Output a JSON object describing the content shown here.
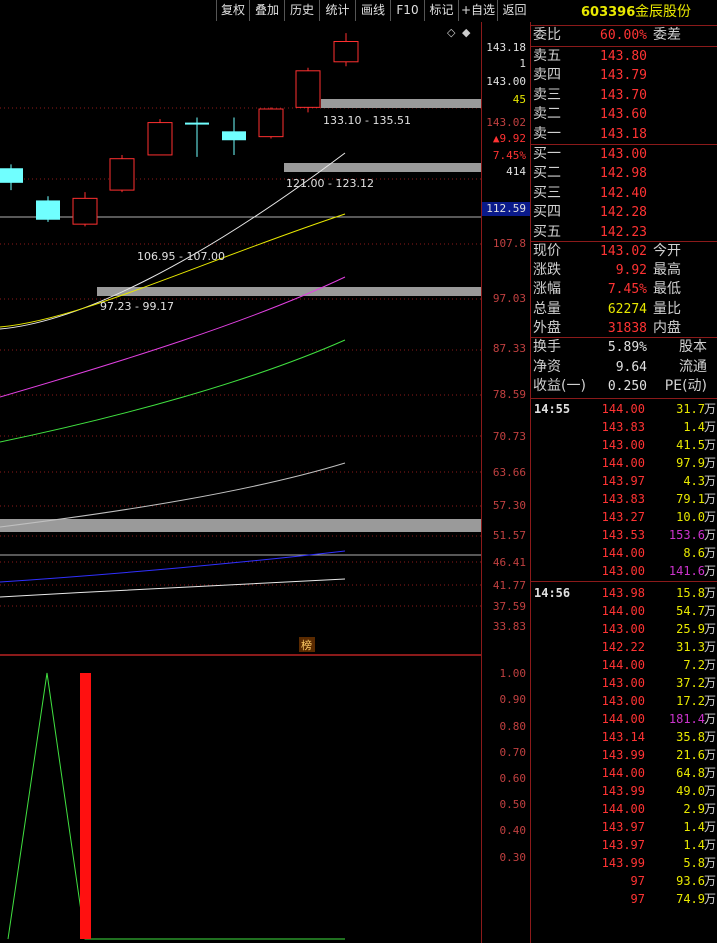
{
  "toolbar": {
    "items": [
      "复权",
      "叠加",
      "历史",
      "统计",
      "画线",
      "F10",
      "标记",
      "+自选",
      "返回"
    ]
  },
  "stock": {
    "code": "603396",
    "name": "金辰股份"
  },
  "order_ratio": {
    "label": "委比",
    "value": "60.00%",
    "label2": "委差"
  },
  "asks": [
    {
      "label": "卖五",
      "price": "143.80",
      "vol": ""
    },
    {
      "label": "卖四",
      "price": "143.79",
      "vol": ""
    },
    {
      "label": "卖三",
      "price": "143.70",
      "vol": ""
    },
    {
      "label": "卖二",
      "price": "143.60",
      "vol": ""
    },
    {
      "label": "卖一",
      "price": "143.18",
      "vol": ""
    }
  ],
  "bids": [
    {
      "label": "买一",
      "price": "143.00"
    },
    {
      "label": "买二",
      "price": "142.98"
    },
    {
      "label": "买三",
      "price": "142.40"
    },
    {
      "label": "买四",
      "price": "142.28"
    },
    {
      "label": "买五",
      "price": "142.23"
    }
  ],
  "quote": [
    {
      "l1": "现价",
      "v1": "143.02",
      "l2": "今开",
      "c": "#ff3333"
    },
    {
      "l1": "涨跌",
      "v1": "9.92",
      "l2": "最高",
      "c": "#ff3333"
    },
    {
      "l1": "涨幅",
      "v1": "7.45%",
      "l2": "最低",
      "c": "#ff3333"
    },
    {
      "l1": "总量",
      "v1": "62274",
      "l2": "量比",
      "c": "#e8e800"
    },
    {
      "l1": "外盘",
      "v1": "31838",
      "l2": "内盘",
      "c": "#ff3333"
    }
  ],
  "stats": [
    {
      "l1": "换手",
      "v1": "5.89%",
      "l2": "股本"
    },
    {
      "l1": "净资",
      "v1": "9.64",
      "l2": "流通"
    },
    {
      "l1": "收益(一)",
      "v1": "0.250",
      "l2": "PE(动)"
    }
  ],
  "trades_1": {
    "time": "14:55",
    "rows": [
      {
        "p": "144.00",
        "v": "31.7",
        "c": "#e8e800"
      },
      {
        "p": "143.83",
        "v": "1.4",
        "c": "#e8e800"
      },
      {
        "p": "143.00",
        "v": "41.5",
        "c": "#e8e800"
      },
      {
        "p": "144.00",
        "v": "97.9",
        "c": "#e8e800"
      },
      {
        "p": "143.97",
        "v": "4.3",
        "c": "#e8e800"
      },
      {
        "p": "143.83",
        "v": "79.1",
        "c": "#e8e800"
      },
      {
        "p": "143.27",
        "v": "10.0",
        "c": "#e8e800"
      },
      {
        "p": "143.53",
        "v": "153.6",
        "c": "#cc33cc"
      },
      {
        "p": "144.00",
        "v": "8.6",
        "c": "#e8e800"
      },
      {
        "p": "143.00",
        "v": "141.6",
        "c": "#cc33cc"
      }
    ]
  },
  "trades_2": {
    "time": "14:56",
    "rows": [
      {
        "p": "143.98",
        "v": "15.8",
        "c": "#e8e800"
      },
      {
        "p": "144.00",
        "v": "54.7",
        "c": "#e8e800"
      },
      {
        "p": "143.00",
        "v": "25.9",
        "c": "#e8e800"
      },
      {
        "p": "142.22",
        "v": "31.3",
        "c": "#e8e800"
      },
      {
        "p": "144.00",
        "v": "7.2",
        "c": "#e8e800"
      },
      {
        "p": "143.00",
        "v": "37.2",
        "c": "#e8e800"
      },
      {
        "p": "143.00",
        "v": "17.2",
        "c": "#e8e800"
      },
      {
        "p": "144.00",
        "v": "181.4",
        "c": "#cc33cc"
      },
      {
        "p": "143.14",
        "v": "35.8",
        "c": "#e8e800"
      },
      {
        "p": "143.99",
        "v": "21.6",
        "c": "#e8e800"
      },
      {
        "p": "144.00",
        "v": "64.8",
        "c": "#e8e800"
      },
      {
        "p": "143.99",
        "v": "49.0",
        "c": "#e8e800"
      },
      {
        "p": "144.00",
        "v": "2.9",
        "c": "#e8e800"
      },
      {
        "p": "143.97",
        "v": "1.4",
        "c": "#e8e800"
      },
      {
        "p": "143.97",
        "v": "1.4",
        "c": "#e8e800"
      },
      {
        "p": "143.99",
        "v": "5.8",
        "c": "#e8e800"
      },
      {
        "p": "97",
        "v": "93.6",
        "c": "#e8e800"
      },
      {
        "p": "97",
        "v": "74.9",
        "c": "#e8e800"
      }
    ]
  },
  "vol_unit": "万",
  "price_axis": {
    "top_labels": [
      {
        "t": "143.18",
        "c": "#e0e0e0"
      },
      {
        "t": "1",
        "c": "#e0e0e0"
      },
      {
        "t": "143.00",
        "c": "#e0e0e0"
      },
      {
        "t": "45",
        "c": "#e8e800"
      },
      {
        "t": "143.02",
        "c": "#c04040"
      },
      {
        "t": "▲9.92",
        "c": "#ff3333"
      },
      {
        "t": "7.45%",
        "c": "#ff3333"
      },
      {
        "t": "414",
        "c": "#e0e0e0"
      }
    ],
    "ticks": [
      "107.8",
      "97.03",
      "87.33",
      "78.59",
      "70.73",
      "63.66",
      "57.30",
      "51.57",
      "46.41",
      "41.77",
      "37.59",
      "33.83"
    ],
    "current": "112.59"
  },
  "zones": [
    {
      "label": "133.10 - 135.51"
    },
    {
      "label": "121.00 - 123.12"
    },
    {
      "label": "106.95 - 107.00"
    },
    {
      "label": "97.23 - 99.17"
    }
  ],
  "marker_glyph": "榜",
  "sub_axis": {
    "ticks": [
      "1.00",
      "0.90",
      "0.80",
      "0.70",
      "0.60",
      "0.50",
      "0.40",
      "0.30"
    ]
  },
  "chart_data": {
    "type": "candlestick",
    "candles": [
      {
        "o": 104.5,
        "c": 100.8,
        "h": 105.5,
        "l": 99.0,
        "color": "cyan"
      },
      {
        "o": 96.5,
        "c": 92.0,
        "h": 97.5,
        "l": 91.5,
        "color": "cyan"
      },
      {
        "o": 91.0,
        "c": 97.0,
        "h": 98.5,
        "l": 90.5,
        "color": "red"
      },
      {
        "o": 99.0,
        "c": 107.0,
        "h": 108.0,
        "l": 98.5,
        "color": "red"
      },
      {
        "o": 108.0,
        "c": 117.0,
        "h": 118.0,
        "l": 108.0,
        "color": "red"
      },
      {
        "o": 117.0,
        "c": 116.5,
        "h": 118.5,
        "l": 107.5,
        "color": "cyan"
      },
      {
        "o": 114.5,
        "c": 112.0,
        "h": 118.5,
        "l": 108.0,
        "color": "cyan"
      },
      {
        "o": 113.0,
        "c": 121.0,
        "h": 121.5,
        "l": 112.5,
        "color": "red"
      },
      {
        "o": 121.5,
        "c": 133.0,
        "h": 134.0,
        "l": 120.0,
        "color": "red"
      },
      {
        "o": 136.0,
        "c": 143.0,
        "h": 146.0,
        "l": 134.5,
        "color": "red"
      }
    ]
  }
}
